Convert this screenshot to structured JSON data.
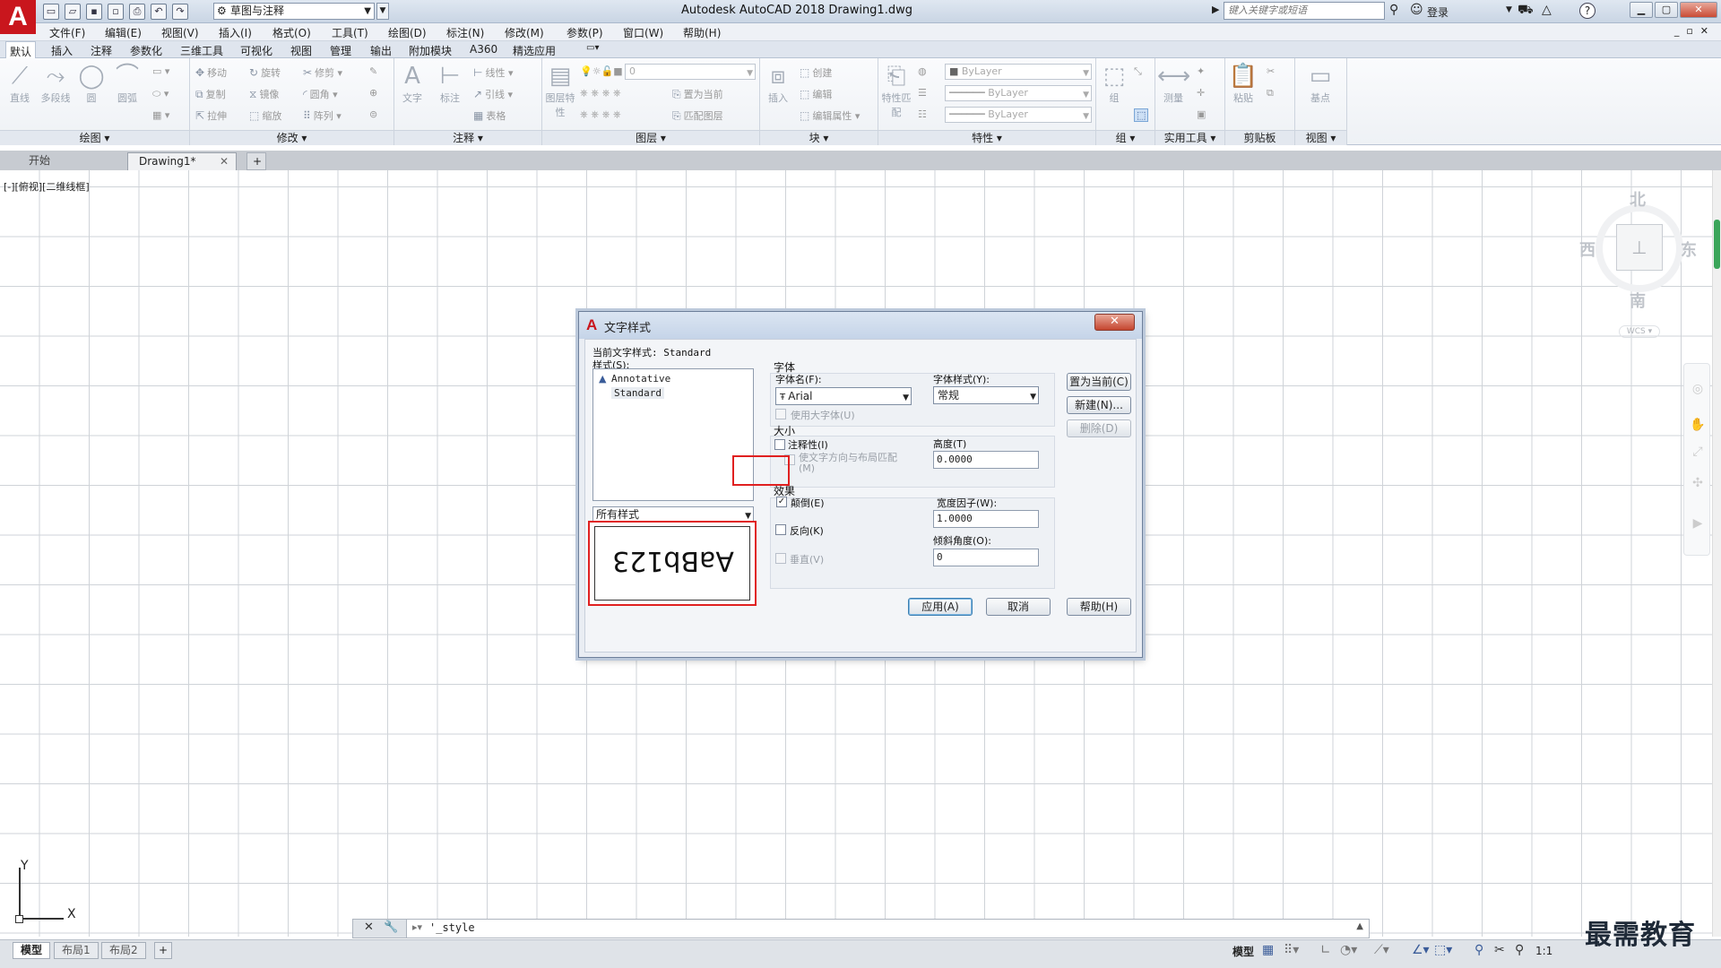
{
  "titlebar": {
    "app_logo": "A",
    "workspace": "草图与注释",
    "title": "Autodesk AutoCAD 2018    Drawing1.dwg",
    "search_placeholder": "键入关键字或短语",
    "login": "登录"
  },
  "menubar": {
    "items": [
      "文件(F)",
      "编辑(E)",
      "视图(V)",
      "插入(I)",
      "格式(O)",
      "工具(T)",
      "绘图(D)",
      "标注(N)",
      "修改(M)",
      "参数(P)",
      "窗口(W)",
      "帮助(H)"
    ]
  },
  "ribbon_tabs": [
    "默认",
    "插入",
    "注释",
    "参数化",
    "三维工具",
    "可视化",
    "视图",
    "管理",
    "输出",
    "附加模块",
    "A360",
    "精选应用"
  ],
  "ribbon": {
    "panels": [
      "绘图",
      "修改",
      "注释",
      "图层",
      "块",
      "特性",
      "组",
      "实用工具",
      "剪贴板",
      "视图"
    ],
    "draw_tools": [
      "直线",
      "多段线",
      "圆",
      "圆弧"
    ],
    "modify_tools": [
      "移动",
      "旋转",
      "修剪",
      "复制",
      "镜像",
      "圆角",
      "拉伸",
      "缩放",
      "阵列"
    ],
    "annotate_tools": [
      "文字",
      "标注",
      "线性",
      "引线",
      "表格"
    ],
    "layer_tools": [
      "图层特性",
      "置为当前",
      "匹配图层"
    ],
    "layer_value": "0",
    "block_tools": [
      "插入",
      "创建",
      "编辑",
      "编辑属性"
    ],
    "property_tools": [
      "特性匹配"
    ],
    "bylayer": [
      "ByLayer",
      "ByLayer",
      "ByLayer"
    ],
    "group_tools": [
      "组"
    ],
    "utility_tools": [
      "测量"
    ],
    "clipboard_tools": [
      "粘贴"
    ],
    "view_tools": [
      "基点"
    ]
  },
  "file_tabs": {
    "start": "开始",
    "drawing": "Drawing1*"
  },
  "viewport_label": "[-][俯视][二维线框]",
  "viewcube": {
    "north": "北",
    "south": "南",
    "east": "东",
    "west": "西",
    "wcs": "WCS"
  },
  "ucs": {
    "x": "X",
    "y": "Y"
  },
  "command": {
    "text": "'_style"
  },
  "status": {
    "layouts": [
      "模型",
      "布局1",
      "布局2"
    ],
    "model": "模型",
    "scale": "1:1"
  },
  "watermark": "最需教育",
  "dialog": {
    "title": "文字样式",
    "current_style": "当前文字样式:  Standard",
    "styles_label": "样式(S):",
    "styles": [
      "Annotative",
      "Standard"
    ],
    "filter": "所有样式",
    "preview_text": "AaBb123",
    "font_group": "字体",
    "font_name_label": "字体名(F):",
    "font_name": "Arial",
    "font_style_label": "字体样式(Y):",
    "font_style": "常规",
    "use_big_font": "使用大字体(U)",
    "size_group": "大小",
    "annotative": "注释性(I)",
    "match_orientation": "使文字方向与布局匹配(M)",
    "height_label": "高度(T)",
    "height": "0.0000",
    "effects_group": "效果",
    "upside_down": "颠倒(E)",
    "backwards": "反向(K)",
    "vertical": "垂直(V)",
    "width_factor_label": "宽度因子(W):",
    "width_factor": "1.0000",
    "oblique_label": "倾斜角度(O):",
    "oblique": "0",
    "buttons": {
      "set_current": "置为当前(C)",
      "new": "新建(N)...",
      "delete": "删除(D)",
      "apply": "应用(A)",
      "cancel": "取消",
      "help": "帮助(H)"
    }
  }
}
